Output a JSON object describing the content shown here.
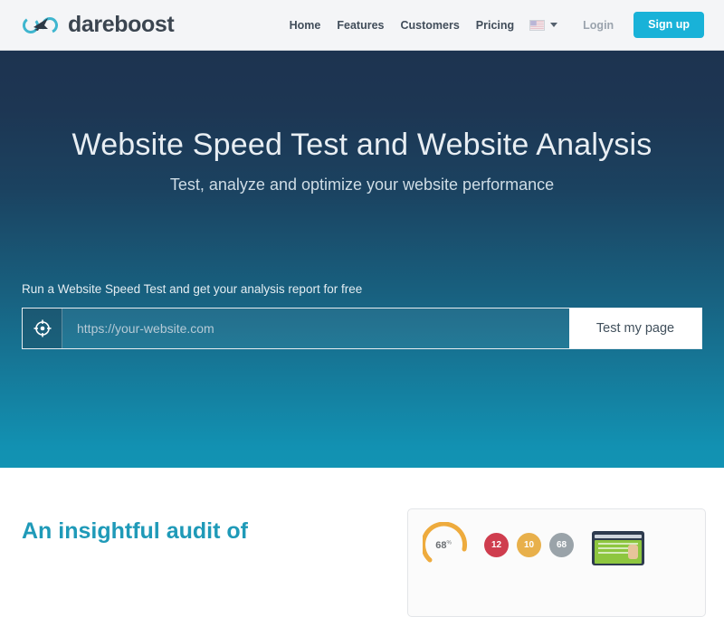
{
  "header": {
    "brand_name": "dareboost",
    "brand_mark_icon": "dareboost-infinity-rocket-logo",
    "nav": [
      {
        "label": "Home",
        "name": "nav-link-home"
      },
      {
        "label": "Features",
        "name": "nav-link-features"
      },
      {
        "label": "Customers",
        "name": "nav-link-customers"
      },
      {
        "label": "Pricing",
        "name": "nav-link-pricing"
      }
    ],
    "language": {
      "flag_icon": "us-flag-icon",
      "caret_icon": "chevron-down-icon"
    },
    "login_label": "Login",
    "signup_label": "Sign up",
    "signup_color": "#19b2d8"
  },
  "hero": {
    "title": "Website Speed Test and Website Analysis",
    "subtitle": "Test, analyze and optimize your website performance",
    "form": {
      "label": "Run a Website Speed Test and get your analysis report for free",
      "url_icon": "crosshair-target-icon",
      "placeholder": "https://your-website.com",
      "value": "",
      "submit_label": "Test my page"
    },
    "gradient_top": "#1d3350",
    "gradient_bottom": "#1293b3"
  },
  "content": {
    "heading": "An insightful audit of",
    "heading_color": "#1f9ab8",
    "report_card": {
      "gauge_score": "68",
      "gauge_unit": "%",
      "gauge_color": "#eeab3d",
      "badges": [
        {
          "value": "12",
          "color": "#cf3d4e",
          "name": "badge-errors"
        },
        {
          "value": "10",
          "color": "#e8b04b",
          "name": "badge-warnings"
        },
        {
          "value": "68",
          "color": "#9aa3a9",
          "name": "badge-info"
        }
      ],
      "thumbnail_icon": "page-screenshot-thumbnail"
    }
  }
}
